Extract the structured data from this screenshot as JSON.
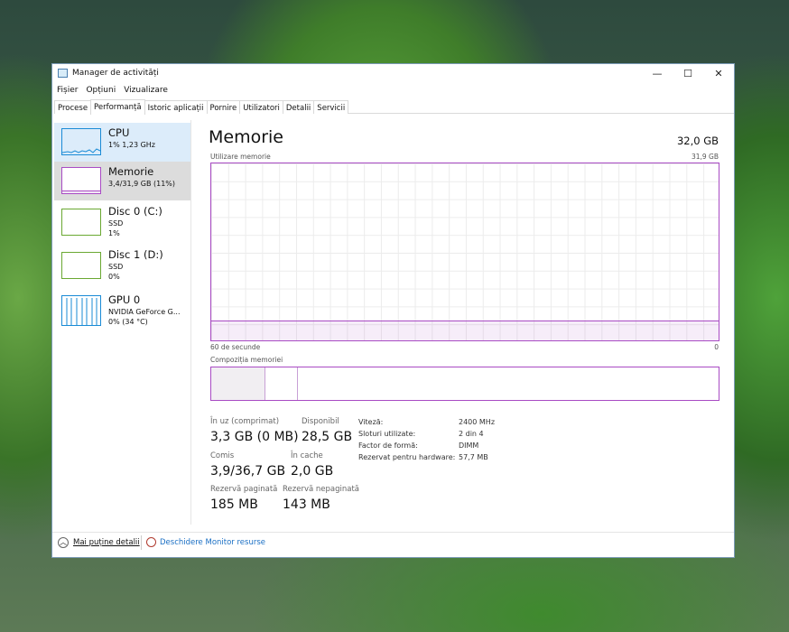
{
  "window": {
    "title": "Manager de activități",
    "controls": {
      "minimize": "—",
      "maximize": "☐",
      "close": "✕"
    }
  },
  "menu": [
    "Fișier",
    "Opțiuni",
    "Vizualizare"
  ],
  "tabs": [
    "Procese",
    "Performanță",
    "Istoric aplicații",
    "Pornire",
    "Utilizatori",
    "Detalii",
    "Servicii"
  ],
  "sidebar": [
    {
      "name": "CPU",
      "line1": "1% 1,23 GHz",
      "line2": ""
    },
    {
      "name": "Memorie",
      "line1": "3,4/31,9 GB (11%)",
      "line2": ""
    },
    {
      "name": "Disc 0 (C:)",
      "line1": "SSD",
      "line2": "1%"
    },
    {
      "name": "Disc 1 (D:)",
      "line1": "SSD",
      "line2": "0%"
    },
    {
      "name": "GPU 0",
      "line1": "NVIDIA GeForce G...",
      "line2": "0% (34 °C)"
    }
  ],
  "main": {
    "title": "Memorie",
    "total": "32,0 GB",
    "graph_label": "Utilizare memorie",
    "graph_max": "31,9 GB",
    "time_left": "60 de secunde",
    "time_right": "0",
    "usage_fraction": 0.11,
    "composition_label": "Compoziția memoriei",
    "stats": [
      {
        "label": "În uz (comprimat)",
        "value": "3,3 GB (0 MB)"
      },
      {
        "label": "Disponibil",
        "value": "28,5 GB"
      },
      {
        "label": "Comis",
        "value": "3,9/36,7 GB"
      },
      {
        "label": "În cache",
        "value": "2,0 GB"
      },
      {
        "label": "Rezervă paginată",
        "value": "185 MB"
      },
      {
        "label": "Rezervă nepaginată",
        "value": "143 MB"
      }
    ],
    "specs": [
      {
        "label": "Viteză:",
        "value": "2400 MHz"
      },
      {
        "label": "Sloturi utilizate:",
        "value": "2 din 4"
      },
      {
        "label": "Factor de formă:",
        "value": "DIMM"
      },
      {
        "label": "Rezervat pentru hardware:",
        "value": "57,7 MB"
      }
    ]
  },
  "footer": {
    "less_details": "Mai puține detalii",
    "resource_monitor": "Deschidere Monitor resurse"
  },
  "colors": {
    "memory": "#a94bc4",
    "cpu": "#1a8bd6",
    "disk": "#6aa832",
    "selected": "#dcdcdc",
    "hover": "#dcecfa"
  }
}
